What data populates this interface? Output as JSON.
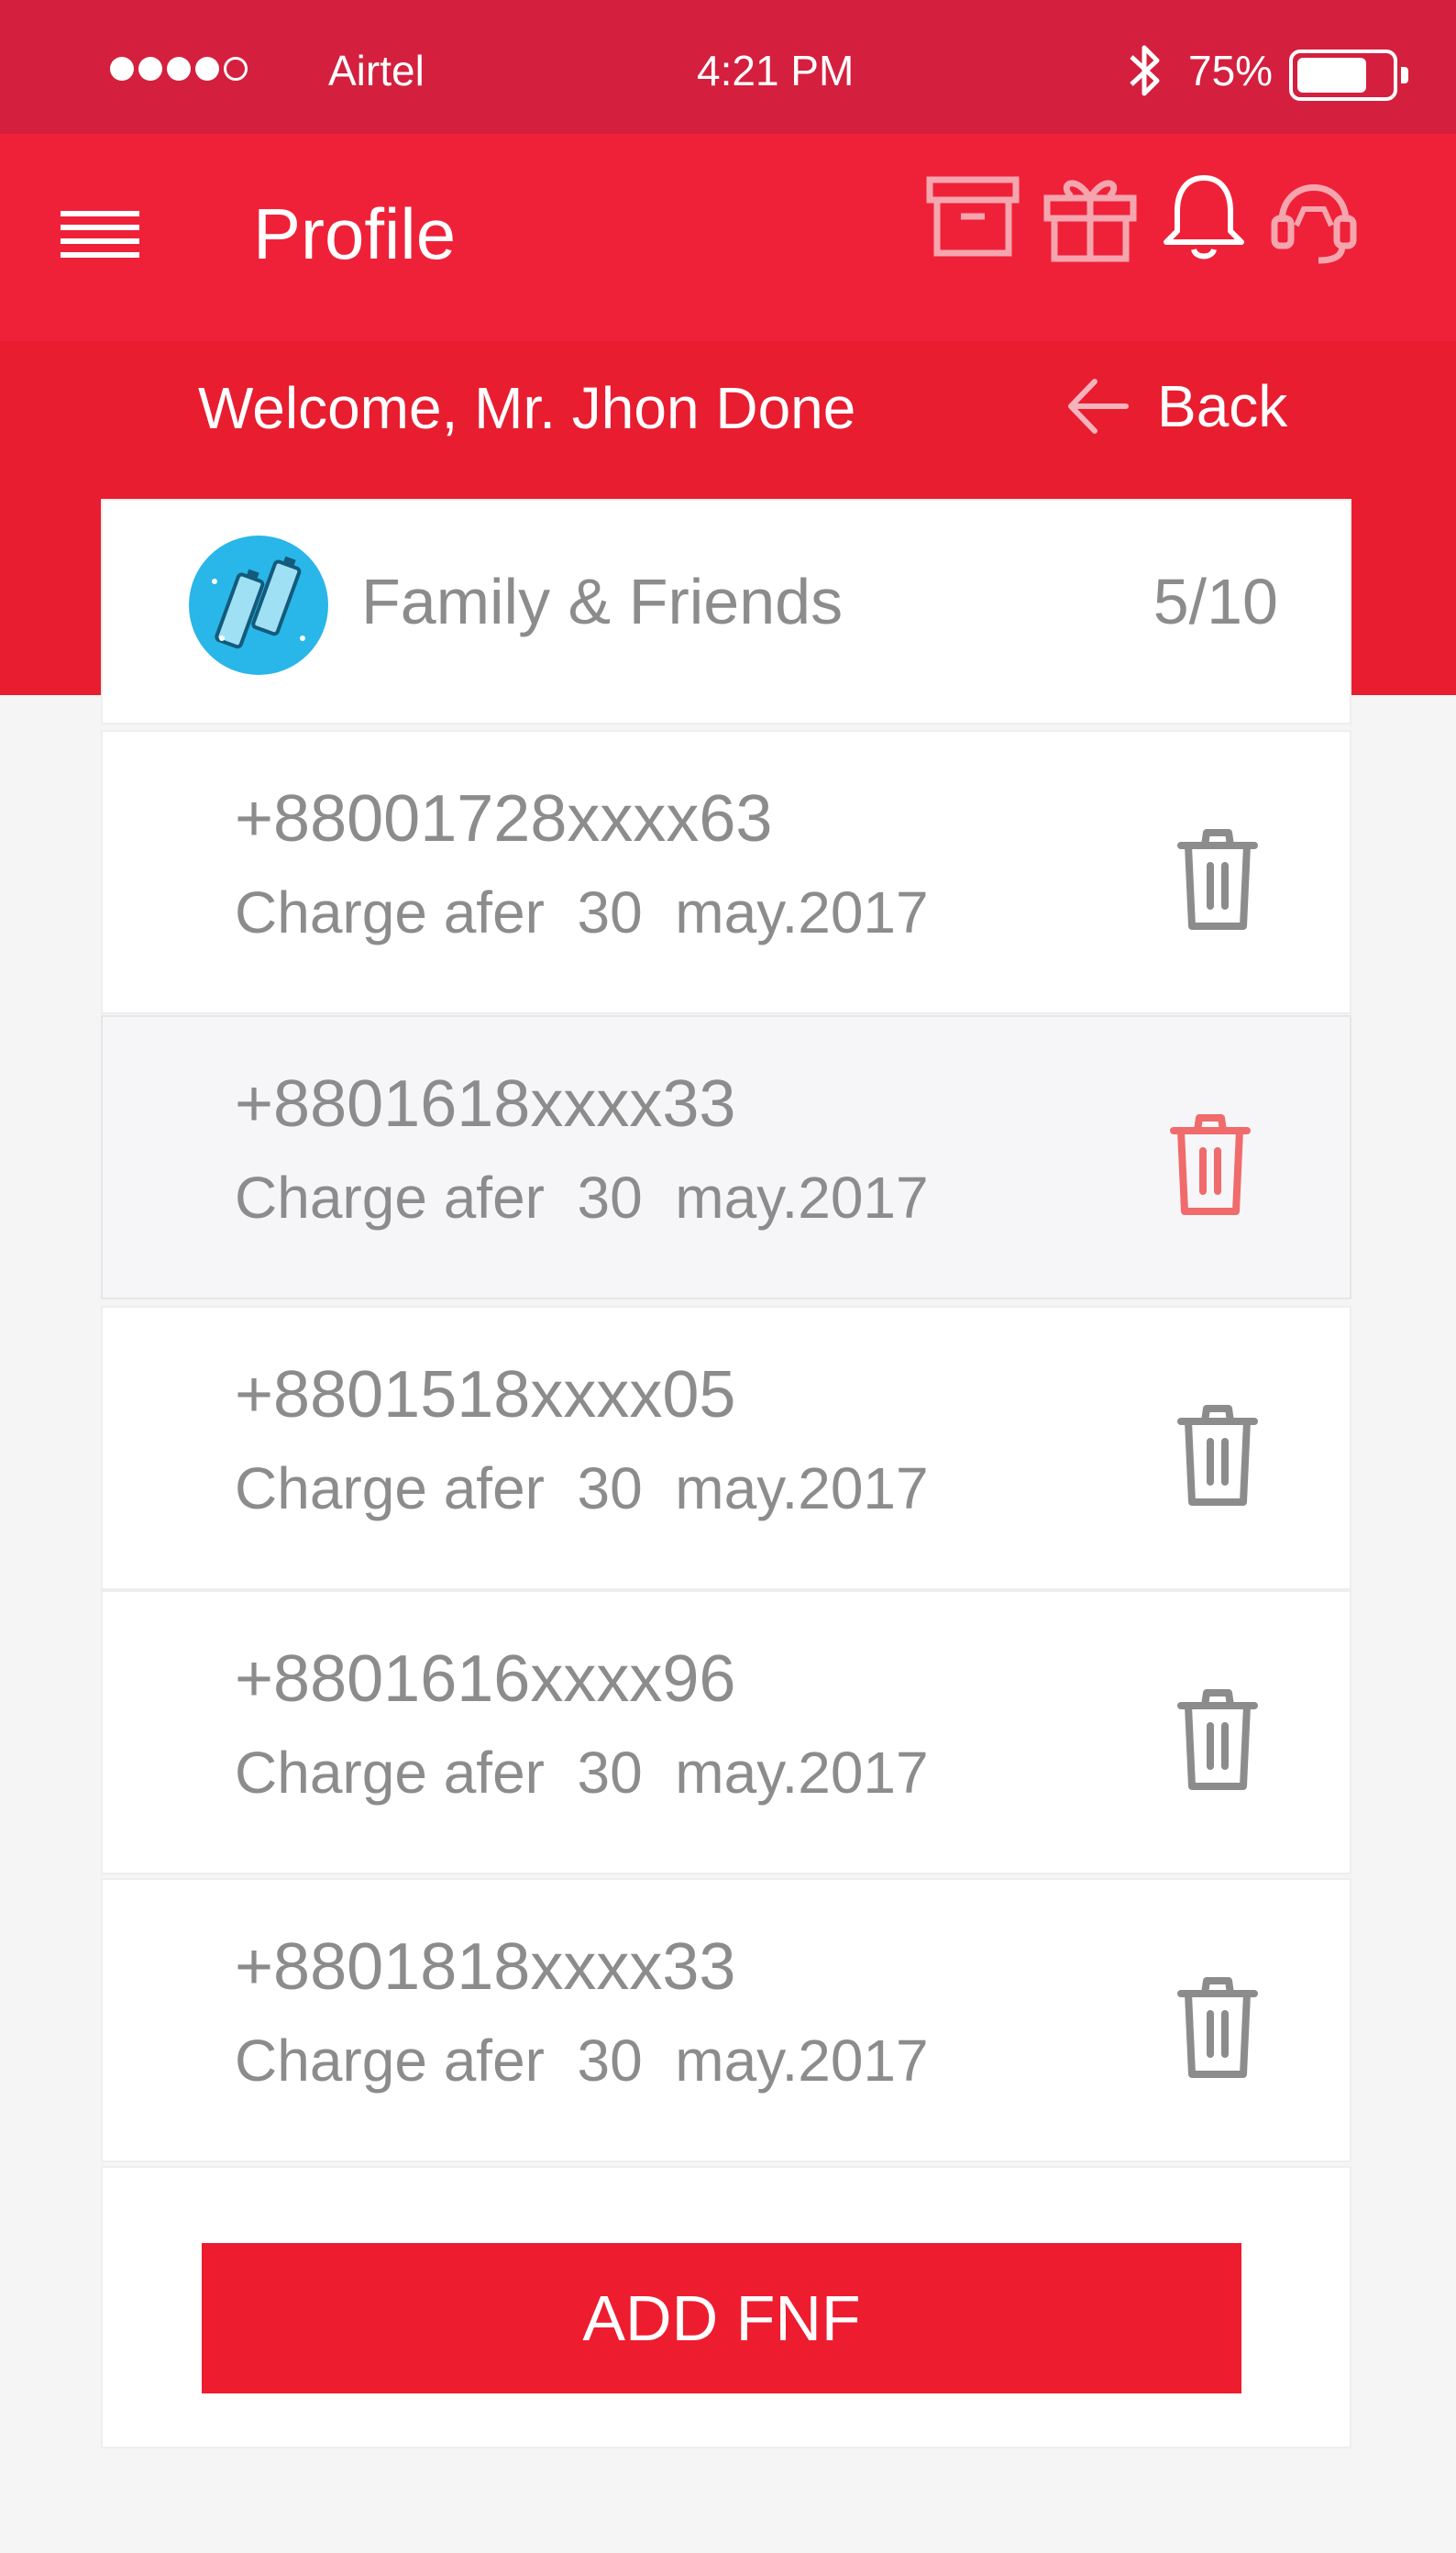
{
  "status_bar": {
    "signal_dots": [
      "filled",
      "filled",
      "filled",
      "filled",
      "empty"
    ],
    "carrier": "Airtel",
    "time": "4:21  PM",
    "battery_text": "75%",
    "battery_level": 0.75
  },
  "header": {
    "title": "Profile",
    "menu_icon": "menu-icon",
    "action_icons": [
      "archive-box-icon",
      "gift-icon",
      "bell-icon",
      "headset-support-icon"
    ]
  },
  "welcome": {
    "text": "Welcome, Mr. Jhon Done",
    "back_label": "Back"
  },
  "fnf_card": {
    "title": "Family & Friends",
    "count": "5/10",
    "icon": "batteries-icon"
  },
  "numbers": [
    {
      "number": "+88001728xxxx63",
      "charge": "Charge afer  30  may.2017",
      "highlighted": false
    },
    {
      "number": "+8801618xxxx33",
      "charge": "Charge afer  30  may.2017",
      "highlighted": true
    },
    {
      "number": "+8801518xxxx05",
      "charge": "Charge afer  30  may.2017",
      "highlighted": false
    },
    {
      "number": "+8801616xxxx96",
      "charge": "Charge afer  30  may.2017",
      "highlighted": false
    },
    {
      "number": "+8801818xxxx33",
      "charge": "Charge afer  30  may.2017",
      "highlighted": false
    }
  ],
  "actions": {
    "add_label": "ADD FNF"
  },
  "colors": {
    "status_bar": "#d41f3e",
    "app_bar": "#ef2139",
    "welcome_band": "#e81d30",
    "accent": "#ee1c2f",
    "trash_default": "#8c8c8c",
    "trash_active": "#f06b6b",
    "text_gray": "#8c8c8c"
  }
}
